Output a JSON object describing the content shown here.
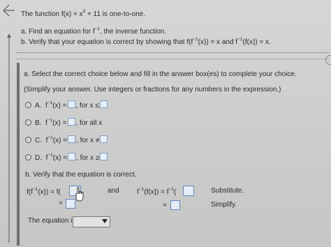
{
  "question": {
    "intro_a": "The function f(x) = x",
    "intro_exp": "3",
    "intro_b": " + 11 is one-to-one.",
    "part_a_a": "a. Find an equation for f",
    "part_a_exp": "−1",
    "part_a_b": ", the inverse function.",
    "part_b_a": "b. Verify that your equation is correct by showing that f(f",
    "part_b_exp1": "−1",
    "part_b_b": "(x)) = x and f",
    "part_b_exp2": "−1",
    "part_b_c": "(f(x)) = x."
  },
  "answer_area": {
    "instruction": "a. Select the correct choice below and fill in the answer box(es) to complete your choice.",
    "hint": "(Simplify your answer. Use integers or fractions for any numbers in the expression.)",
    "choices": [
      {
        "letter": "A.",
        "pre": "f",
        "exp": "−1",
        "mid": "(x) =",
        "cond": ", for x ≤"
      },
      {
        "letter": "B.",
        "pre": "f",
        "exp": "−1",
        "mid": "(x) =",
        "cond": ", for all x"
      },
      {
        "letter": "C.",
        "pre": "f",
        "exp": "−1",
        "mid": "(x) =",
        "cond": ", for x ≠"
      },
      {
        "letter": "D.",
        "pre": "f",
        "exp": "−1",
        "mid": "(x) =",
        "cond": ", for x ≥"
      }
    ],
    "verify_heading": "b. Verify that the equation is correct.",
    "left_expr_a": "f(f",
    "left_expr_exp": "−1",
    "left_expr_b": "(x)) = f(",
    "left_expr_c": ")",
    "equals": "=",
    "and_label": "and",
    "right_expr_a": "f",
    "right_expr_exp": "−1",
    "right_expr_b": "(f(x)) = f",
    "right_expr_exp2": "−1",
    "right_expr_c": "(",
    "right_expr_d": ")",
    "substitute_label": "Substitute.",
    "simplify_label": "Simplify.",
    "equation_is_label": "The equation is",
    "equation_select_value": ""
  },
  "colors": {
    "answer_box_border": "#5f88c2",
    "background": "#d2d2d0"
  }
}
